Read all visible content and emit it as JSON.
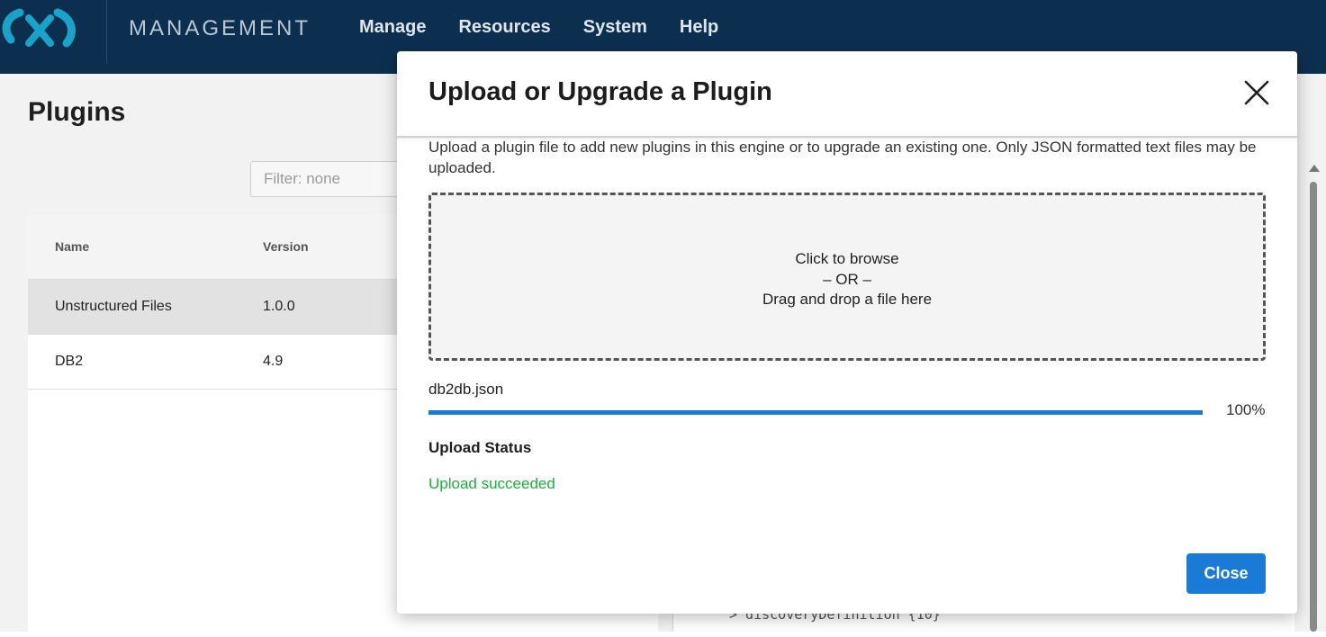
{
  "header": {
    "brand": "MANAGEMENT",
    "nav": [
      "Manage",
      "Resources",
      "System",
      "Help"
    ]
  },
  "page": {
    "title": "Plugins",
    "filter_placeholder": "Filter: none",
    "table": {
      "columns": [
        "Name",
        "Version"
      ],
      "rows": [
        {
          "name": "Unstructured Files",
          "version": "1.0.0"
        },
        {
          "name": "DB2",
          "version": "4.9"
        }
      ]
    },
    "code_fragment": "> discoveryDefinition {10}"
  },
  "modal": {
    "title": "Upload or Upgrade a Plugin",
    "description": "Upload a plugin file to add new plugins in this engine or to upgrade an existing one. Only JSON formatted text files may be uploaded.",
    "dropzone": {
      "line1": "Click to browse",
      "line2": "– OR –",
      "line3": "Drag and drop a file here"
    },
    "file": {
      "name": "db2db.json",
      "progress_percent": 100,
      "progress_label": "100%"
    },
    "status_label": "Upload Status",
    "status_text": "Upload succeeded",
    "close_button": "Close"
  },
  "colors": {
    "header_bg": "#0d2f4f",
    "accent": "#1a7bd6",
    "success": "#1fae3e",
    "logo": "#1aa3c8"
  },
  "icons": {
    "logo": "brand-logo-icon",
    "close": "close-icon",
    "scroll_up": "scroll-up-arrow-icon"
  }
}
